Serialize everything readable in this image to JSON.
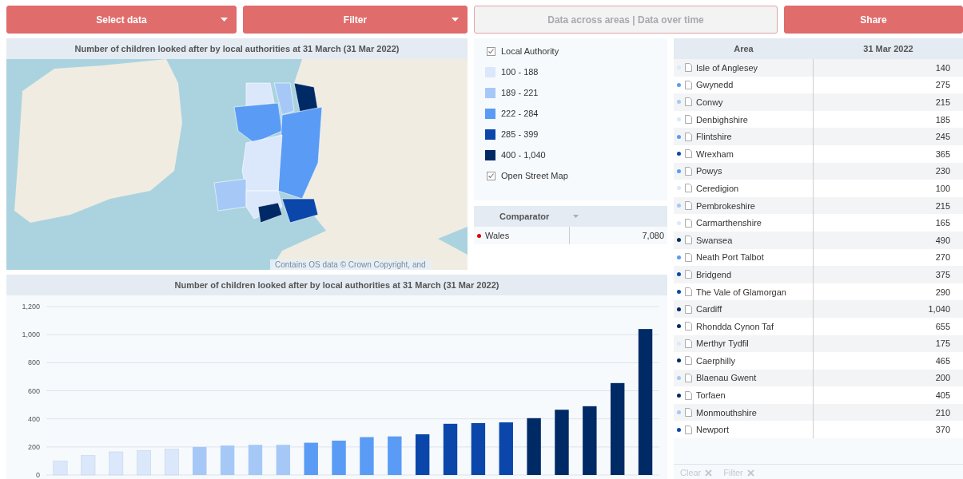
{
  "toolbar": {
    "buttons": [
      {
        "label": "Select data",
        "kind": "dropdown",
        "disabled": false
      },
      {
        "label": "Filter",
        "kind": "dropdown",
        "disabled": false
      },
      {
        "label": "Data across areas | Data over time",
        "kind": "plain",
        "disabled": true
      },
      {
        "label": "Share",
        "kind": "plain",
        "disabled": false
      }
    ]
  },
  "map_panel": {
    "title": "Number of children looked after by local authorities at 31 March (31 Mar 2022)",
    "attribution": "Contains OS data © Crown Copyright, and"
  },
  "legend": {
    "items": [
      {
        "kind": "checkbox",
        "label": "Local Authority",
        "checked": true
      },
      {
        "kind": "swatch",
        "label": "100 - 188",
        "color": "#dbe8fb"
      },
      {
        "kind": "swatch",
        "label": "189 - 221",
        "color": "#a6c8f7"
      },
      {
        "kind": "swatch",
        "label": "222 - 284",
        "color": "#5a9cf5"
      },
      {
        "kind": "swatch",
        "label": "285 - 399",
        "color": "#0b47ab"
      },
      {
        "kind": "swatch",
        "label": "400 - 1,040",
        "color": "#002a66"
      },
      {
        "kind": "checkbox",
        "label": "Open Street Map",
        "checked": true
      }
    ]
  },
  "comparator": {
    "title": "Comparator",
    "rows": [
      {
        "name": "Wales",
        "value": "7,080",
        "color": "#e00000"
      }
    ]
  },
  "chart_panel": {
    "title": "Number of children looked after by local authorities at 31 March (31 Mar 2022)",
    "chart_data": {
      "type": "bar",
      "ylim": [
        0,
        1200
      ],
      "yticks": [
        {
          "value": 0,
          "label": "0"
        },
        {
          "value": 200,
          "label": "200"
        },
        {
          "value": 400,
          "label": "400"
        },
        {
          "value": 600,
          "label": "600"
        },
        {
          "value": 800,
          "label": "800"
        },
        {
          "value": 1000,
          "label": "1,000"
        },
        {
          "value": 1200,
          "label": "1,200"
        }
      ],
      "grid": true,
      "series": [
        {
          "color": "#dbe8fb",
          "values": [
            100,
            140,
            165,
            175,
            185,
            null,
            null,
            null,
            null,
            null,
            null,
            null,
            null,
            null,
            null,
            null,
            null,
            null,
            null,
            null,
            null,
            null
          ]
        },
        {
          "color": "#a6c8f7",
          "values": [
            null,
            null,
            null,
            null,
            null,
            200,
            210,
            215,
            215,
            null,
            null,
            null,
            null,
            null,
            null,
            null,
            null,
            null,
            null,
            null,
            null,
            null
          ]
        },
        {
          "color": "#5a9cf5",
          "values": [
            null,
            null,
            null,
            null,
            null,
            null,
            null,
            null,
            null,
            230,
            245,
            270,
            275,
            null,
            null,
            null,
            null,
            null,
            null,
            null,
            null,
            null
          ]
        },
        {
          "color": "#0b47ab",
          "values": [
            null,
            null,
            null,
            null,
            null,
            null,
            null,
            null,
            null,
            null,
            null,
            null,
            null,
            290,
            365,
            370,
            375,
            null,
            null,
            null,
            null,
            null
          ]
        },
        {
          "color": "#002a66",
          "values": [
            null,
            null,
            null,
            null,
            null,
            null,
            null,
            null,
            null,
            null,
            null,
            null,
            null,
            null,
            null,
            null,
            null,
            405,
            465,
            490,
            655,
            1040
          ]
        }
      ]
    }
  },
  "table": {
    "columns": [
      "Area",
      "31 Mar 2022"
    ],
    "rows": [
      {
        "area": "Isle of Anglesey",
        "value": "140",
        "color": "#dbe8fb"
      },
      {
        "area": "Gwynedd",
        "value": "275",
        "color": "#5a9cf5"
      },
      {
        "area": "Conwy",
        "value": "215",
        "color": "#a6c8f7"
      },
      {
        "area": "Denbighshire",
        "value": "185",
        "color": "#dbe8fb"
      },
      {
        "area": "Flintshire",
        "value": "245",
        "color": "#5a9cf5"
      },
      {
        "area": "Wrexham",
        "value": "365",
        "color": "#0b47ab"
      },
      {
        "area": "Powys",
        "value": "230",
        "color": "#5a9cf5"
      },
      {
        "area": "Ceredigion",
        "value": "100",
        "color": "#dbe8fb"
      },
      {
        "area": "Pembrokeshire",
        "value": "215",
        "color": "#a6c8f7"
      },
      {
        "area": "Carmarthenshire",
        "value": "165",
        "color": "#dbe8fb"
      },
      {
        "area": "Swansea",
        "value": "490",
        "color": "#002a66"
      },
      {
        "area": "Neath Port Talbot",
        "value": "270",
        "color": "#5a9cf5"
      },
      {
        "area": "Bridgend",
        "value": "375",
        "color": "#0b47ab"
      },
      {
        "area": "The Vale of Glamorgan",
        "value": "290",
        "color": "#0b47ab"
      },
      {
        "area": "Cardiff",
        "value": "1,040",
        "color": "#002a66"
      },
      {
        "area": "Rhondda Cynon Taf",
        "value": "655",
        "color": "#002a66"
      },
      {
        "area": "Merthyr Tydfil",
        "value": "175",
        "color": "#dbe8fb"
      },
      {
        "area": "Caerphilly",
        "value": "465",
        "color": "#002a66"
      },
      {
        "area": "Blaenau Gwent",
        "value": "200",
        "color": "#a6c8f7"
      },
      {
        "area": "Torfaen",
        "value": "405",
        "color": "#002a66"
      },
      {
        "area": "Monmouthshire",
        "value": "210",
        "color": "#a6c8f7"
      },
      {
        "area": "Newport",
        "value": "370",
        "color": "#0b47ab"
      }
    ],
    "footer": [
      "Clear",
      "Filter"
    ]
  }
}
